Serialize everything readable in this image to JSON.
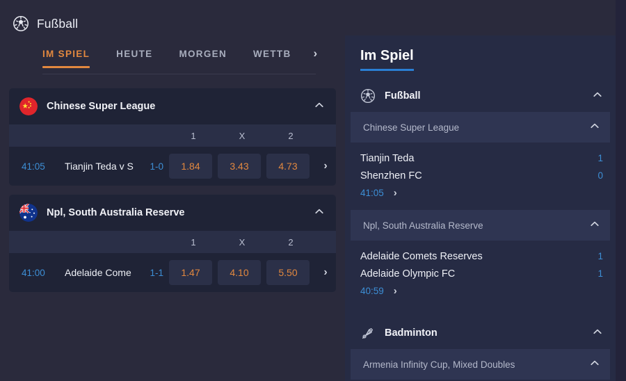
{
  "left": {
    "sport_header": {
      "icon": "soccer-ball-icon",
      "title": "Fußball"
    },
    "tabs": [
      {
        "label": "IM SPIEL",
        "active": true
      },
      {
        "label": "HEUTE",
        "active": false
      },
      {
        "label": "MORGEN",
        "active": false
      },
      {
        "label": "WETTB",
        "active": false
      }
    ],
    "tabs_next_icon": "›",
    "odds_columns": [
      "1",
      "X",
      "2"
    ],
    "cards": [
      {
        "flag": "china-flag-icon",
        "league": "Chinese Super League",
        "collapse_icon": "chevron-up-icon",
        "matches": [
          {
            "time": "41:05",
            "teams": "Tianjin Teda v S",
            "score": "1-0",
            "odds": [
              "1.84",
              "3.43",
              "4.73"
            ],
            "next_icon": "›"
          }
        ]
      },
      {
        "flag": "australia-flag-icon",
        "league": "Npl, South Australia Reserve",
        "collapse_icon": "chevron-up-icon",
        "matches": [
          {
            "time": "41:00",
            "teams": "Adelaide Come",
            "score": "1-1",
            "odds": [
              "1.47",
              "4.10",
              "5.50"
            ],
            "next_icon": "›"
          }
        ]
      }
    ]
  },
  "right": {
    "title": "Im Spiel",
    "sections": [
      {
        "icon": "soccer-ball-icon",
        "name": "Fußball",
        "collapse_icon": "chevron-up-icon",
        "leagues": [
          {
            "name": "Chinese Super League",
            "collapse_icon": "chevron-up-icon",
            "events": [
              {
                "home": "Tianjin Teda",
                "away": "Shenzhen FC",
                "home_score": "1",
                "away_score": "0",
                "time": "41:05",
                "next_icon": "›"
              }
            ]
          },
          {
            "name": "Npl, South Australia Reserve",
            "collapse_icon": "chevron-up-icon",
            "events": [
              {
                "home": "Adelaide Comets Reserves",
                "away": "Adelaide Olympic FC",
                "home_score": "1",
                "away_score": "1",
                "time": "40:59",
                "next_icon": "›"
              }
            ]
          }
        ]
      },
      {
        "icon": "shuttlecock-icon",
        "name": "Badminton",
        "collapse_icon": "chevron-up-icon",
        "leagues": [
          {
            "name": "Armenia Infinity Cup, Mixed Doubles",
            "collapse_icon": "chevron-up-icon",
            "events": []
          }
        ]
      }
    ]
  },
  "colors": {
    "page_background": "#2a2a3c",
    "card_background": "#1f2336",
    "right_panel_background": "#262b44",
    "accent_orange": "#e2883f",
    "accent_blue": "#3d8fd6",
    "underline_blue": "#2a7fd4",
    "odds_button": "#2b3048",
    "column_header": "#2a2f47",
    "league_subheader": "#2f3552"
  }
}
